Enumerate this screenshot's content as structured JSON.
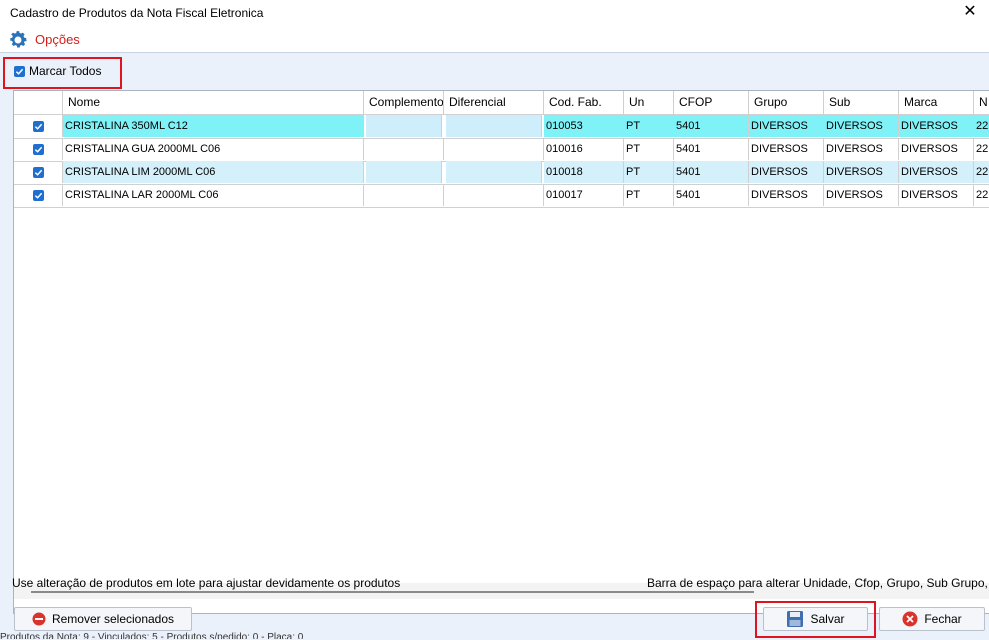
{
  "window": {
    "title": "Cadastro de Produtos da Nota Fiscal Eletronica",
    "close_glyph": "✕"
  },
  "menu": {
    "options_label": "Opções",
    "icon": "gear-icon"
  },
  "mark_all": {
    "label": "Marcar Todos",
    "checked": true
  },
  "grid": {
    "columns": [
      "Nome",
      "Complemento",
      "Diferencial",
      "Cod. Fab.",
      "Un",
      "CFOP",
      "Grupo",
      "Sub",
      "Marca",
      "N"
    ],
    "rows": [
      {
        "checked": true,
        "nome": "CRISTALINA 350ML C12",
        "complemento": "",
        "diferencial": "",
        "cod_fab": "010053",
        "un": "PT",
        "cfop": "5401",
        "grupo": "DIVERSOS",
        "sub": "DIVERSOS",
        "marca": "DIVERSOS",
        "n": "22"
      },
      {
        "checked": true,
        "nome": "CRISTALINA GUA 2000ML C06",
        "complemento": "",
        "diferencial": "",
        "cod_fab": "010016",
        "un": "PT",
        "cfop": "5401",
        "grupo": "DIVERSOS",
        "sub": "DIVERSOS",
        "marca": "DIVERSOS",
        "n": "22"
      },
      {
        "checked": true,
        "nome": "CRISTALINA LIM 2000ML C06",
        "complemento": "",
        "diferencial": "",
        "cod_fab": "010018",
        "un": "PT",
        "cfop": "5401",
        "grupo": "DIVERSOS",
        "sub": "DIVERSOS",
        "marca": "DIVERSOS",
        "n": "22"
      },
      {
        "checked": true,
        "nome": "CRISTALINA LAR 2000ML C06",
        "complemento": "",
        "diferencial": "",
        "cod_fab": "010017",
        "un": "PT",
        "cfop": "5401",
        "grupo": "DIVERSOS",
        "sub": "DIVERSOS",
        "marca": "DIVERSOS",
        "n": "22"
      }
    ]
  },
  "footer": {
    "hint_left": "Use alteração de produtos em lote para ajustar devidamente os produtos",
    "hint_right": "Barra de espaço para alterar Unidade, Cfop, Grupo, Sub Grupo, Marca",
    "remove_label": "Remover selecionados",
    "save_label": "Salvar",
    "close_label": "Fechar",
    "status_text": "Produtos da Nota: 9 - Vinculados: 5 - Produtos s/pedido: 0 - Placa: 0"
  },
  "colors": {
    "accent_red": "#e0141e",
    "menu_red": "#d1201c",
    "selected_row": "#7ff2f8",
    "checkbox_blue": "#1e6fd0"
  }
}
